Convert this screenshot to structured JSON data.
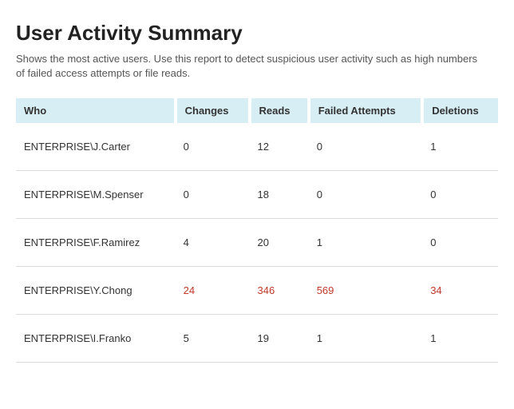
{
  "title": "User Activity Summary",
  "subtitle": "Shows the most active users. Use this report to detect suspicious user activity such as high numbers of failed access attempts or file reads.",
  "columns": [
    "Who",
    "Changes",
    "Reads",
    "Failed Attempts",
    "Deletions"
  ],
  "rows": [
    {
      "who": "ENTERPRISE\\J.Carter",
      "changes": "0",
      "reads": "12",
      "failed": "0",
      "deletions": "1",
      "alert": false
    },
    {
      "who": "ENTERPRISE\\M.Spenser",
      "changes": "0",
      "reads": "18",
      "failed": "0",
      "deletions": "0",
      "alert": false
    },
    {
      "who": "ENTERPRISE\\F.Ramirez",
      "changes": "4",
      "reads": "20",
      "failed": "1",
      "deletions": "0",
      "alert": false
    },
    {
      "who": "ENTERPRISE\\Y.Chong",
      "changes": "24",
      "reads": "346",
      "failed": "569",
      "deletions": "34",
      "alert": true
    },
    {
      "who": "ENTERPRISE\\I.Franko",
      "changes": "5",
      "reads": "19",
      "failed": "1",
      "deletions": "1",
      "alert": false
    }
  ]
}
